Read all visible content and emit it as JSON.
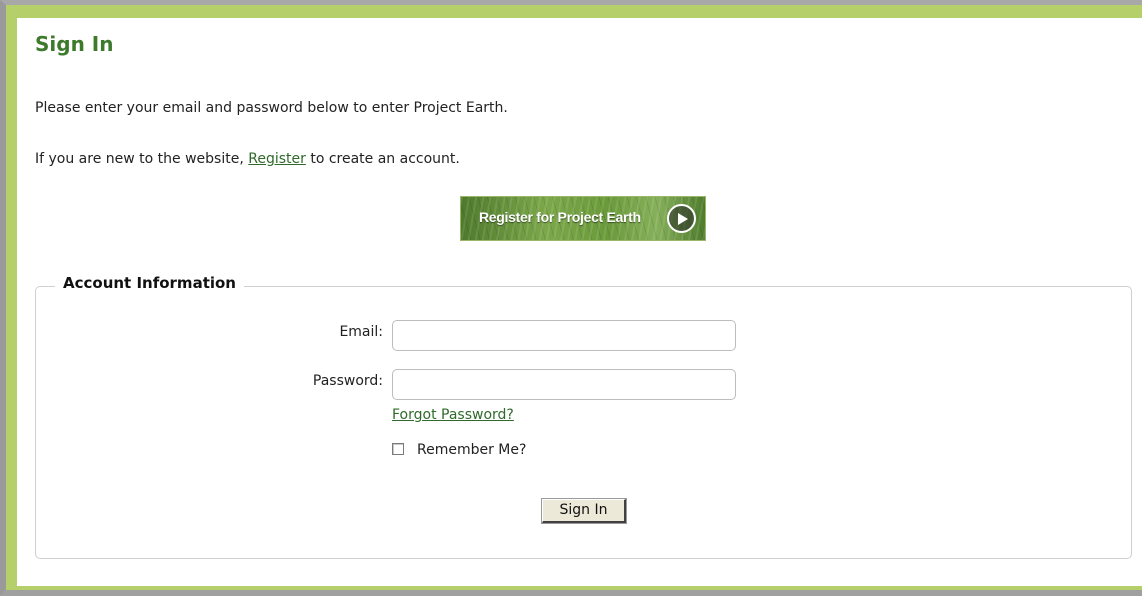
{
  "page": {
    "title": "Sign In",
    "intro_text": "Please enter your email and password below to enter Project Earth.",
    "new_user_prefix": "If you are new to the website, ",
    "register_link": "Register",
    "new_user_suffix": " to create an account.",
    "register_button": "Register for Project Earth"
  },
  "account": {
    "legend": "Account Information",
    "email_label": "Email:",
    "email_value": "",
    "password_label": "Password:",
    "password_value": "",
    "forgot_link": "Forgot Password?",
    "remember_label": "Remember Me?",
    "remember_checked": false,
    "signin_button": "Sign In"
  },
  "colors": {
    "accent_green": "#3d7a2c",
    "frame_green": "#b5cf6a",
    "link_green": "#2f6a2a"
  },
  "icons": {
    "register_arrow": "arrow-right-circle-icon"
  }
}
